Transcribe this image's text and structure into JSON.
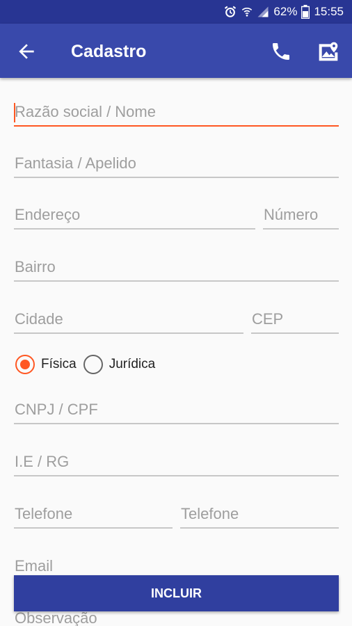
{
  "status_bar": {
    "battery_percent": "62%",
    "time": "15:55",
    "icons": [
      "alarm-icon",
      "wifi-icon",
      "signal-icon",
      "battery-icon"
    ]
  },
  "app_bar": {
    "title": "Cadastro",
    "icons": [
      "arrow-back-icon",
      "phone-icon",
      "map-icon"
    ]
  },
  "form": {
    "razao_social": {
      "placeholder": "Razão social / Nome",
      "value": ""
    },
    "fantasia": {
      "placeholder": "Fantasia / Apelido",
      "value": ""
    },
    "endereco": {
      "placeholder": "Endereço",
      "value": ""
    },
    "numero": {
      "placeholder": "Número",
      "value": ""
    },
    "bairro": {
      "placeholder": "Bairro",
      "value": ""
    },
    "cidade": {
      "placeholder": "Cidade",
      "value": ""
    },
    "cep": {
      "placeholder": "CEP",
      "value": ""
    },
    "tipo_pessoa": {
      "options": [
        "Física",
        "Jurídica"
      ],
      "selected": "Física"
    },
    "cnpj_cpf": {
      "placeholder": "CNPJ / CPF",
      "value": ""
    },
    "ie_rg": {
      "placeholder": "I.E / RG",
      "value": ""
    },
    "telefone1": {
      "placeholder": "Telefone",
      "value": ""
    },
    "telefone2": {
      "placeholder": "Telefone",
      "value": ""
    },
    "email": {
      "placeholder": "Email",
      "value": ""
    },
    "observacao": {
      "placeholder": "Observação",
      "value": ""
    }
  },
  "include_button": {
    "label": "INCLUIR"
  },
  "colors": {
    "status_bar": "#283593",
    "app_bar": "#3949ab",
    "accent": "#ff5722",
    "button": "#303f9f"
  }
}
